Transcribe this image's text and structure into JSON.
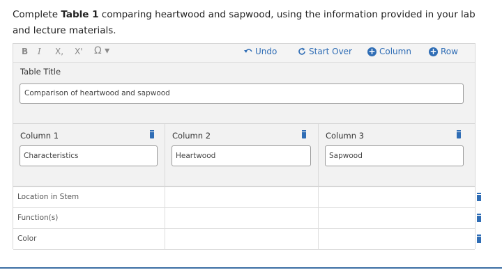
{
  "prompt": {
    "before": "Complete ",
    "bold": "Table 1",
    "after": " comparing heartwood and sapwood, using the information provided in your lab and lecture materials."
  },
  "toolbar": {
    "bold_label": "B",
    "italic_label": "I",
    "subscript_label": "X,",
    "superscript_label": "X'",
    "special_char_label": "Ω ▾",
    "undo_label": "Undo",
    "start_over_label": "Start Over",
    "add_column_label": "Column",
    "add_row_label": "Row"
  },
  "table_title": {
    "label": "Table Title",
    "value": "Comparison of heartwood and sapwood"
  },
  "columns": [
    {
      "label": "Column 1",
      "value": "Characteristics"
    },
    {
      "label": "Column 2",
      "value": "Heartwood"
    },
    {
      "label": "Column 3",
      "value": "Sapwood"
    }
  ],
  "rows": [
    {
      "label": "Location in Stem",
      "cells": [
        "",
        ""
      ]
    },
    {
      "label": "Function(s)",
      "cells": [
        "",
        ""
      ]
    },
    {
      "label": "Color",
      "cells": [
        "",
        ""
      ]
    }
  ],
  "colors": {
    "accent": "#2f6db5",
    "panel_bg": "#f2f2f2",
    "border": "#9a9a9a"
  }
}
